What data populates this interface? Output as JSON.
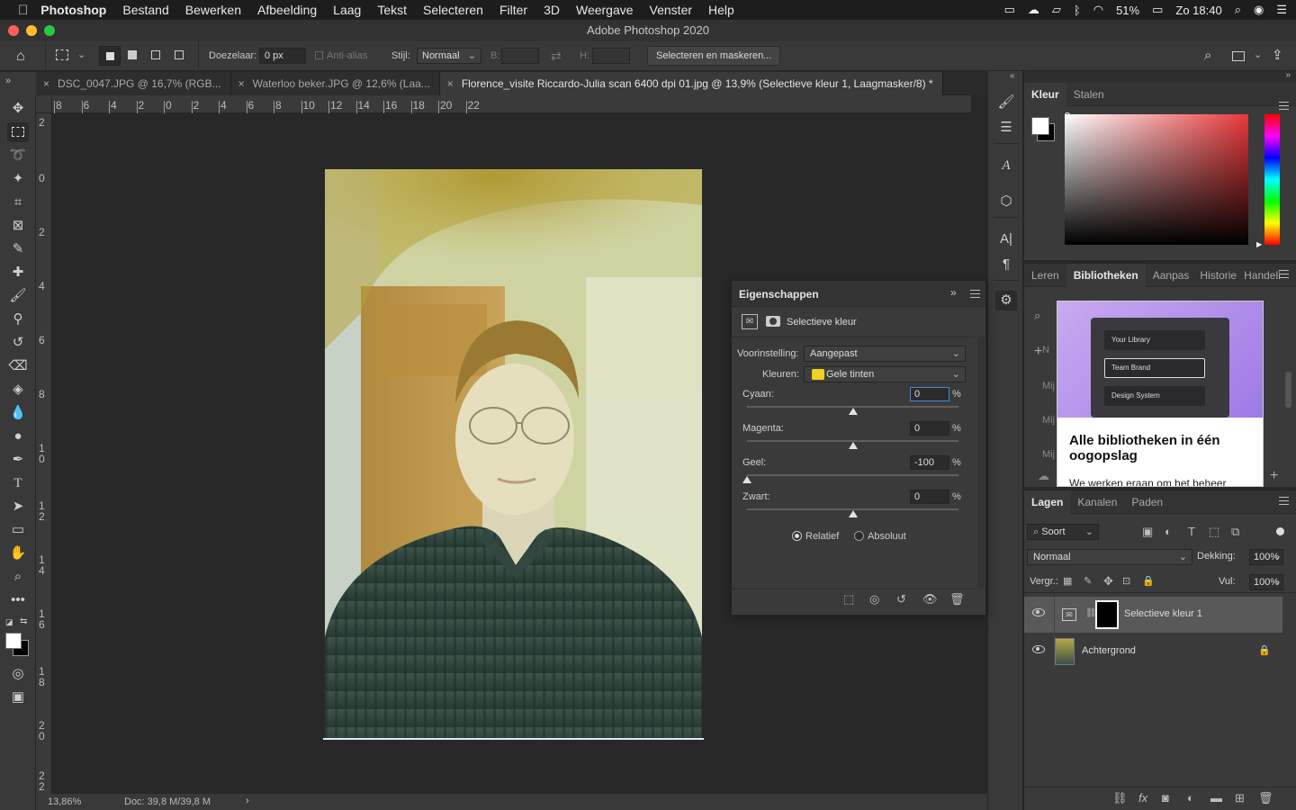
{
  "menubar": {
    "app_name": "Photoshop",
    "items": [
      "Bestand",
      "Bewerken",
      "Afbeelding",
      "Laag",
      "Tekst",
      "Selecteren",
      "Filter",
      "3D",
      "Weergave",
      "Venster",
      "Help"
    ],
    "battery": "51%",
    "clock": "Zo 18:40"
  },
  "window": {
    "title": "Adobe Photoshop 2020"
  },
  "options_bar": {
    "feather_label": "Doezelaar:",
    "feather_value": "0 px",
    "antialias_label": "Anti-alias",
    "style_label": "Stijl:",
    "style_value": "Normaal",
    "width_label": "B:",
    "height_label": "H:",
    "select_mask_button": "Selecteren en maskeren..."
  },
  "tabs": [
    {
      "label": "DSC_0047.JPG @ 16,7% (RGB..."
    },
    {
      "label": "Waterloo beker.JPG @ 12,6% (Laa..."
    },
    {
      "label": "Florence_visite Riccardo-Julia scan 6400 dpi 01.jpg @ 13,9% (Selectieve kleur 1, Laagmasker/8) *"
    }
  ],
  "ruler": {
    "h_labels": [
      "8",
      "6",
      "4",
      "2",
      "0",
      "2",
      "4",
      "6",
      "8",
      "10",
      "12",
      "14",
      "16",
      "18",
      "20",
      "22"
    ],
    "v_labels": [
      "2",
      "0",
      "2",
      "4",
      "6",
      "8",
      "1\n0",
      "1\n2",
      "1\n4",
      "1\n6",
      "1\n8",
      "2\n0",
      "2\n2"
    ]
  },
  "statusbar": {
    "zoom": "13,86%",
    "doc_info": "Doc: 39,8 M/39,8 M"
  },
  "properties": {
    "title": "Eigenschappen",
    "adjustment_name": "Selectieve kleur",
    "preset_label": "Voorinstelling:",
    "preset_value": "Aangepast",
    "colors_label": "Kleuren:",
    "colors_value": "Gele tinten",
    "colors_swatch": "#f0d020",
    "sliders": [
      {
        "label": "Cyaan:",
        "value": "0",
        "unit": "%",
        "level": 0
      },
      {
        "label": "Magenta:",
        "value": "0",
        "unit": "%",
        "level": 0
      },
      {
        "label": "Geel:",
        "value": "-100",
        "unit": "%",
        "level": -100
      },
      {
        "label": "Zwart:",
        "value": "0",
        "unit": "%",
        "level": 0
      }
    ],
    "method_relative": "Relatief",
    "method_absolute": "Absoluut"
  },
  "color_panel": {
    "tab_active": "Kleur",
    "tab_other": "Stalen"
  },
  "libraries_panel": {
    "tabs": [
      "Leren",
      "Bibliotheken",
      "Aanpas",
      "Historie",
      "Handeli"
    ],
    "promo_items": [
      "Your Library",
      "Team Brand",
      "Design System"
    ],
    "promo_title": "Alle bibliotheken in één oogopslag",
    "promo_text": "We werken eraan om het beheer",
    "list_stub": [
      "Mij",
      "Mij",
      "Mij"
    ]
  },
  "layers_panel": {
    "tabs": [
      "Lagen",
      "Kanalen",
      "Paden"
    ],
    "filter_value": "Soort",
    "blend_mode": "Normaal",
    "opacity_label": "Dekking:",
    "opacity_value": "100%",
    "lock_label": "Vergr.:",
    "fill_label": "Vul:",
    "fill_value": "100%",
    "layers": [
      {
        "name": "Selectieve kleur 1"
      },
      {
        "name": "Achtergrond"
      }
    ]
  }
}
